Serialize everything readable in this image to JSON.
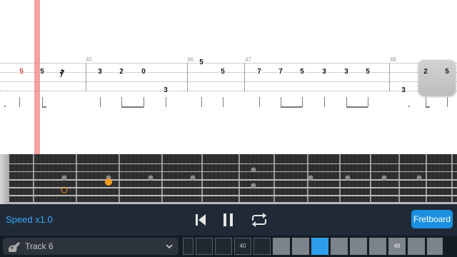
{
  "tab": {
    "bar_numbers": [
      "45",
      "46",
      "47",
      "48"
    ],
    "notes": [
      {
        "fret": "4",
        "string": 4,
        "color": "black"
      },
      {
        "fret": "5",
        "string": 2,
        "color": "red"
      },
      {
        "fret": "5",
        "string": 2,
        "color": "black"
      },
      {
        "fret": "3",
        "string": 2,
        "color": "black"
      },
      {
        "fret": "2",
        "string": 2,
        "color": "black"
      },
      {
        "fret": "0",
        "string": 2,
        "color": "black"
      },
      {
        "fret": "3",
        "string": 4,
        "color": "black"
      },
      {
        "fret": "5",
        "string": 1,
        "color": "black"
      },
      {
        "fret": "5",
        "string": 2,
        "color": "black"
      },
      {
        "fret": "7",
        "string": 2,
        "color": "black"
      },
      {
        "fret": "7",
        "string": 2,
        "color": "black"
      },
      {
        "fret": "5",
        "string": 2,
        "color": "black"
      },
      {
        "fret": "3",
        "string": 2,
        "color": "black"
      },
      {
        "fret": "3",
        "string": 2,
        "color": "black"
      },
      {
        "fret": "5",
        "string": 2,
        "color": "black"
      },
      {
        "fret": "3",
        "string": 4,
        "color": "black"
      },
      {
        "fret": "2",
        "string": 2,
        "color": "black"
      },
      {
        "fret": "5",
        "string": 2,
        "color": "black"
      }
    ],
    "rest_symbol": "𝄿"
  },
  "fretboard": {
    "marker_hollow_color": "#e8901a",
    "marker_filled_color": "#f5a01f"
  },
  "controls": {
    "speed_label": "Speed x1.0",
    "fretboard_button": "Fretboard",
    "icons": [
      "skip-back-icon",
      "pause-icon",
      "loop-icon"
    ]
  },
  "bottom": {
    "track_label": "Track 6",
    "bar_40": "40",
    "bar_48": "48",
    "active_color": "#2f9ee8"
  }
}
